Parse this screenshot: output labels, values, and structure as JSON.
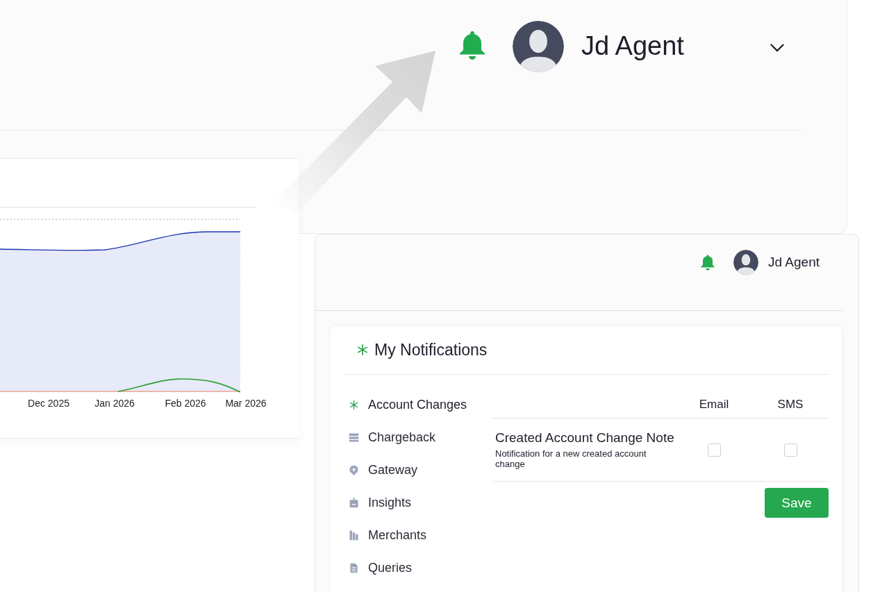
{
  "header": {
    "user_name": "Jd Agent"
  },
  "chart": {
    "x_labels": [
      "Dec 2025",
      "Jan 2026",
      "Feb 2026",
      "Mar 2026"
    ]
  },
  "panel": {
    "header": {
      "user_name": "Jd Agent"
    },
    "title": "My Notifications",
    "menu": [
      {
        "label": "Account Changes",
        "kind": "asterisk",
        "selected": true
      },
      {
        "label": "Chargeback",
        "kind": "server",
        "selected": false
      },
      {
        "label": "Gateway",
        "kind": "pin",
        "selected": false
      },
      {
        "label": "Insights",
        "kind": "tray",
        "selected": false
      },
      {
        "label": "Merchants",
        "kind": "grid",
        "selected": false
      },
      {
        "label": "Queries",
        "kind": "document",
        "selected": false
      }
    ],
    "table": {
      "columns": [
        "Email",
        "SMS"
      ],
      "rows": [
        {
          "title": "Created Account Change Note",
          "description": "Notification for a new created account change",
          "email": false,
          "sms": false
        }
      ]
    },
    "save_button": "Save"
  }
}
